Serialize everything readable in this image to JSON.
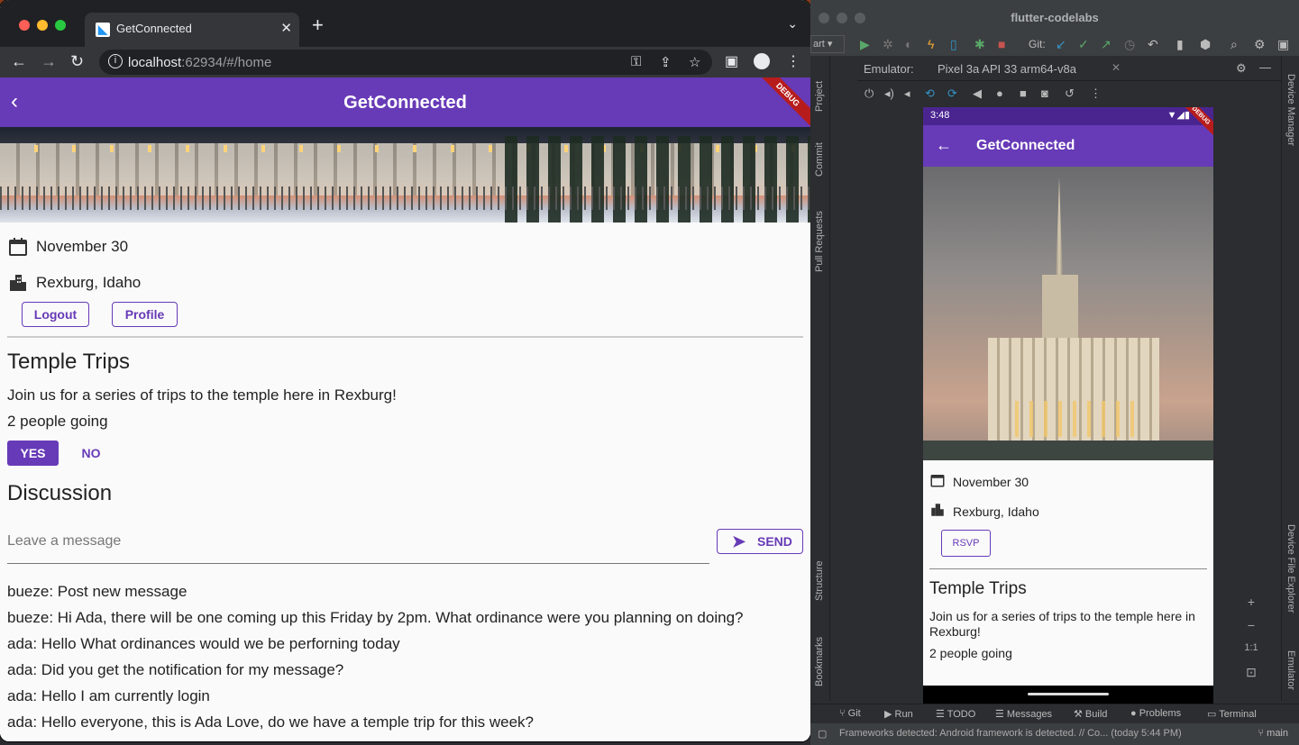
{
  "browser": {
    "tab_title": "GetConnected",
    "tab_close": "✕",
    "new_tab": "+",
    "url_host": "localhost",
    "url_rest": ":62934/#/home"
  },
  "app": {
    "title": "GetConnected",
    "debug": "DEBUG",
    "date": "November 30",
    "location": "Rexburg, Idaho",
    "logout_label": "Logout",
    "profile_label": "Profile",
    "section_title": "Temple Trips",
    "description": "Join us for a series of trips to the temple here in Rexburg!",
    "attendees": "2 people going",
    "yes_label": "YES",
    "no_label": "NO",
    "discussion_title": "Discussion",
    "message_placeholder": "Leave a message",
    "send_label": "SEND",
    "messages": [
      "bueze: Post new message",
      "bueze: Hi Ada, there will be one coming up this Friday by 2pm. What ordinance were you planning on doing?",
      "ada: Hello What ordinances would we be perforning today",
      "ada: Did you get the notification for my message?",
      "ada: Hello I am currently login",
      "ada: Hello everyone, this is Ada Love, do we have a temple trip for this week?"
    ]
  },
  "studio": {
    "window_title": "flutter-codelabs",
    "run_config": "art",
    "git_label": "Git:",
    "emulator_label": "Emulator:",
    "device_name": "Pixel 3a API 33 arm64-v8a",
    "left_tools": [
      "Project",
      "Commit",
      "Pull Requests",
      "Structure",
      "Bookmarks"
    ],
    "right_tools": [
      "Device Manager",
      "Device File Explorer",
      "Emulator"
    ],
    "bottom_tools": [
      "Git",
      "Run",
      "TODO",
      "Messages",
      "Build",
      "Problems",
      "Terminal"
    ],
    "status_text": "Frameworks detected: Android framework is detected. // Co... (today 5:44 PM)",
    "branch": "main",
    "zoom_one": "1:1"
  },
  "phone": {
    "time": "3:48",
    "title": "GetConnected",
    "debug": "DEBUG",
    "date": "November 30",
    "location": "Rexburg, Idaho",
    "rsvp_label": "RSVP",
    "section_title": "Temple Trips",
    "description": "Join us for a series of trips to the temple here in Rexburg!",
    "attendees": "2 people going"
  },
  "colors": {
    "accent": "#673ab7",
    "debug_banner": "#b71c1c"
  }
}
